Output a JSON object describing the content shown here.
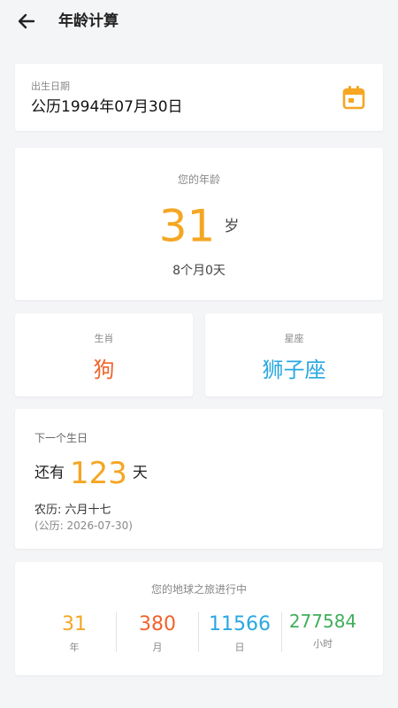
{
  "header": {
    "title": "年龄计算",
    "back_icon": "arrow-left-icon"
  },
  "birth": {
    "label": "出生日期",
    "value": "公历1994年07月30日",
    "calendar_icon": "calendar-icon"
  },
  "age": {
    "label": "您的年龄",
    "years": "31",
    "unit": "岁",
    "detail": "8个月0天"
  },
  "zodiac": {
    "label": "生肖",
    "value": "狗"
  },
  "constellation": {
    "label": "星座",
    "value": "狮子座"
  },
  "next_birthday": {
    "label": "下一个生日",
    "prefix": "还有",
    "days": "123",
    "suffix": "天",
    "lunar": "农历: 六月十七",
    "solar": "(公历: 2026-07-30)"
  },
  "journey": {
    "title": "您的地球之旅进行中",
    "stats": [
      {
        "value": "31",
        "unit": "年"
      },
      {
        "value": "380",
        "unit": "月"
      },
      {
        "value": "11566",
        "unit": "日"
      },
      {
        "value": "277584",
        "unit": "小时"
      }
    ]
  },
  "colors": {
    "accent_orange": "#f5a623",
    "zodiac_red": "#f0632b",
    "star_blue": "#29a8e0",
    "hours_green": "#3fae5a"
  }
}
